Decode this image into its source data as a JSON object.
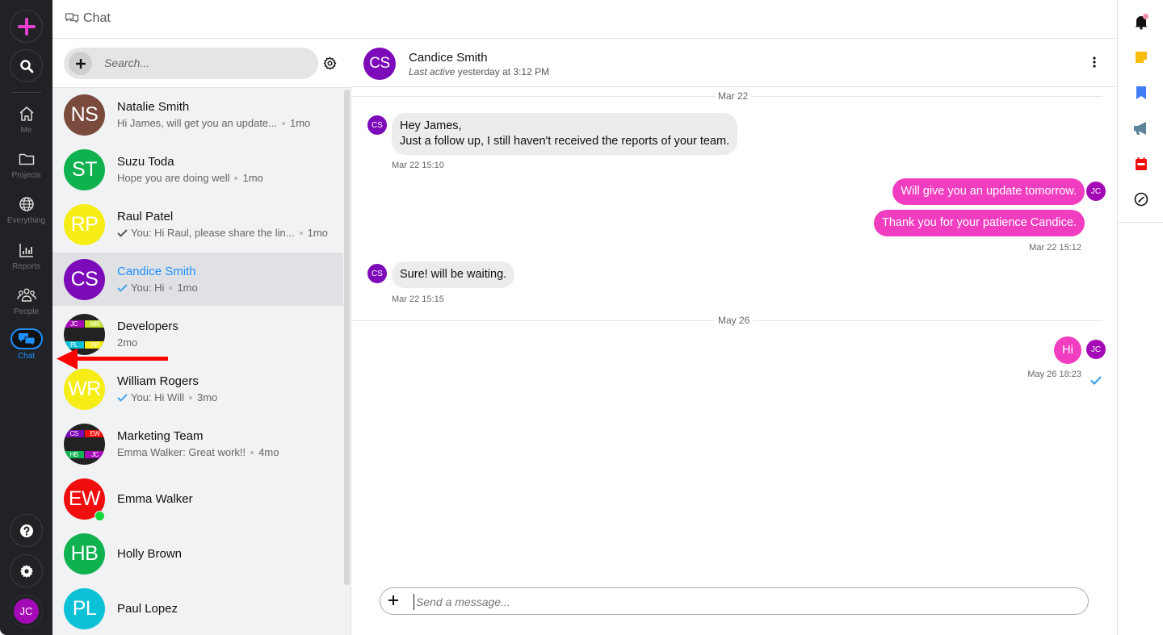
{
  "app": {
    "section_title": "Chat",
    "colors": {
      "accent": "#1e90ff",
      "outgoing_bubble": "#f13ec0",
      "incoming_bubble": "#ececec",
      "rail_bg": "#202226"
    }
  },
  "rail": {
    "top_buttons": [
      {
        "name": "create",
        "icon": "plus-icon"
      },
      {
        "name": "search",
        "icon": "search-icon"
      }
    ],
    "items": [
      {
        "label": "Me",
        "icon": "home-icon"
      },
      {
        "label": "Projects",
        "icon": "folder-icon"
      },
      {
        "label": "Everything",
        "icon": "globe-icon"
      },
      {
        "label": "Reports",
        "icon": "bar-chart-icon"
      },
      {
        "label": "People",
        "icon": "people-icon"
      },
      {
        "label": "Chat",
        "icon": "chat-bubbles-icon",
        "active": true
      }
    ],
    "bottom_buttons": [
      {
        "name": "help",
        "icon": "help-icon"
      },
      {
        "name": "settings",
        "icon": "gear-icon"
      }
    ],
    "user_initials": "JC"
  },
  "search": {
    "placeholder": "Search...",
    "value": ""
  },
  "conversations": [
    {
      "initials": "NS",
      "name": "Natalie Smith",
      "preview": "Hi James, will get you an update...",
      "time": "1mo",
      "color": "#7a4b3d"
    },
    {
      "initials": "ST",
      "name": "Suzu Toda",
      "preview": "Hope you are doing well",
      "time": "1mo",
      "color": "#0fb24f"
    },
    {
      "initials": "RP",
      "name": "Raul Patel",
      "preview": "You: Hi Raul, please share the lin...",
      "time": "1mo",
      "color": "#f6ec16",
      "check": "grey"
    },
    {
      "initials": "CS",
      "name": "Candice Smith",
      "preview": "You: Hi",
      "time": "1mo",
      "color": "#7c0ab8",
      "check": "blue",
      "selected": true
    },
    {
      "name": "Developers",
      "preview": "",
      "time": "2mo",
      "group": [
        {
          "initials": "JC",
          "color": "#a30ab5"
        },
        {
          "initials": "MR",
          "color": "#c5e02d"
        },
        {
          "initials": "PL",
          "color": "#0cc0d6"
        },
        {
          "initials": "RP",
          "color": "#f6ec16"
        }
      ]
    },
    {
      "initials": "WR",
      "name": "William Rogers",
      "preview": "You: Hi Will",
      "time": "3mo",
      "color": "#f6ec16",
      "check": "blue"
    },
    {
      "name": "Marketing Team",
      "preview": "Emma Walker: Great work!!",
      "time": "4mo",
      "group": [
        {
          "initials": "CS",
          "color": "#7c0ab8"
        },
        {
          "initials": "EW",
          "color": "#f00d0d"
        },
        {
          "initials": "HB",
          "color": "#0fb24f"
        },
        {
          "initials": "JC",
          "color": "#a30ab5"
        }
      ]
    },
    {
      "initials": "EW",
      "name": "Emma Walker",
      "color": "#f00d0d",
      "online": true
    },
    {
      "initials": "HB",
      "name": "Holly Brown",
      "color": "#0fb24f"
    },
    {
      "initials": "PL",
      "name": "Paul Lopez",
      "color": "#0cc0d6"
    }
  ],
  "active_chat": {
    "initials": "CS",
    "name": "Candice Smith",
    "status_prefix": "Last active",
    "status_rest": " yesterday at 3:12 PM",
    "date_separators": [
      "Mar 22",
      "May 26"
    ],
    "messages": [
      {
        "from": "CS",
        "direction": "in",
        "lines": [
          "Hey James,",
          "Just a follow up, I still haven't received the reports of your team."
        ],
        "time": "Mar 22 15:10"
      },
      {
        "from": "JC",
        "direction": "out",
        "lines": [
          "Will give you an update tomorrow."
        ]
      },
      {
        "from": "JC",
        "direction": "out",
        "lines": [
          "Thank you for your patience Candice."
        ],
        "time": "Mar 22 15:12"
      },
      {
        "from": "CS",
        "direction": "in",
        "lines": [
          "Sure! will be waiting."
        ],
        "time": "Mar 22 15:15"
      },
      {
        "from": "JC",
        "direction": "out",
        "lines": [
          "Hi"
        ],
        "time": "May 26 18:23",
        "read": true
      }
    ]
  },
  "composer": {
    "placeholder": "Send a message...",
    "value": ""
  },
  "utility_rail": [
    {
      "icon": "bell-icon",
      "color": "#111",
      "badge": true
    },
    {
      "icon": "sticky-note-icon",
      "color": "#f8bd0a"
    },
    {
      "icon": "bookmark-icon",
      "color": "#3f7cf5"
    },
    {
      "icon": "megaphone-icon",
      "color": "#5b8498"
    },
    {
      "icon": "calendar-icon",
      "color": "#f00d0d"
    },
    {
      "icon": "timer-icon",
      "color": "#111"
    }
  ]
}
